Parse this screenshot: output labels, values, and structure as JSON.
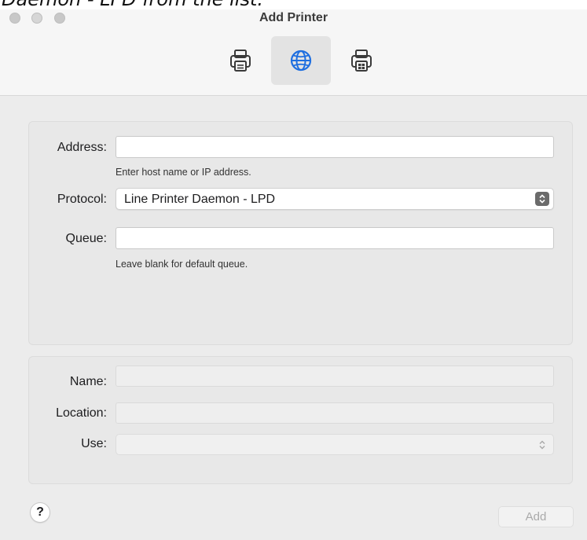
{
  "background_caption": "Daemon - LPD from the list.",
  "window": {
    "title": "Add Printer"
  },
  "toolbar": {
    "buttons": [
      {
        "icon": "default-printer-icon",
        "selected": false
      },
      {
        "icon": "ip-globe-icon",
        "selected": true
      },
      {
        "icon": "windows-printer-icon",
        "selected": false
      }
    ]
  },
  "form": {
    "address_label": "Address:",
    "address_value": "",
    "address_hint": "Enter host name or IP address.",
    "protocol_label": "Protocol:",
    "protocol_value": "Line Printer Daemon - LPD",
    "queue_label": "Queue:",
    "queue_value": "",
    "queue_hint": "Leave blank for default queue."
  },
  "details": {
    "name_label": "Name:",
    "name_value": "",
    "location_label": "Location:",
    "location_value": "",
    "use_label": "Use:",
    "use_value": ""
  },
  "footer": {
    "help_label": "?",
    "add_label": "Add"
  },
  "colors": {
    "window_bg": "#ececec",
    "panel_bg": "#e8e8e8",
    "selected_tab_bg": "#e3e3e3",
    "globe_accent": "#1f6fe0"
  }
}
